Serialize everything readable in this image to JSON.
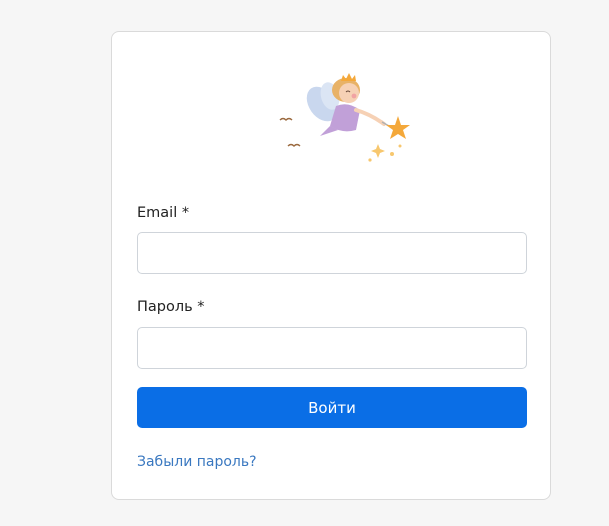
{
  "form": {
    "email_label": "Email *",
    "email_value": "",
    "email_placeholder": "",
    "password_label": "Пароль *",
    "password_value": "",
    "password_placeholder": "",
    "submit_label": "Войти",
    "forgot_link": "Забыли пароль?"
  },
  "logo": {
    "icon": "fairy-on-moon-icon"
  },
  "colors": {
    "page_background": "#f6f6f6",
    "card_background": "#ffffff",
    "primary_button": "#0a6ee6",
    "link": "#3a78c0",
    "moon": "#f7cf85",
    "star": "#f4a83a"
  }
}
